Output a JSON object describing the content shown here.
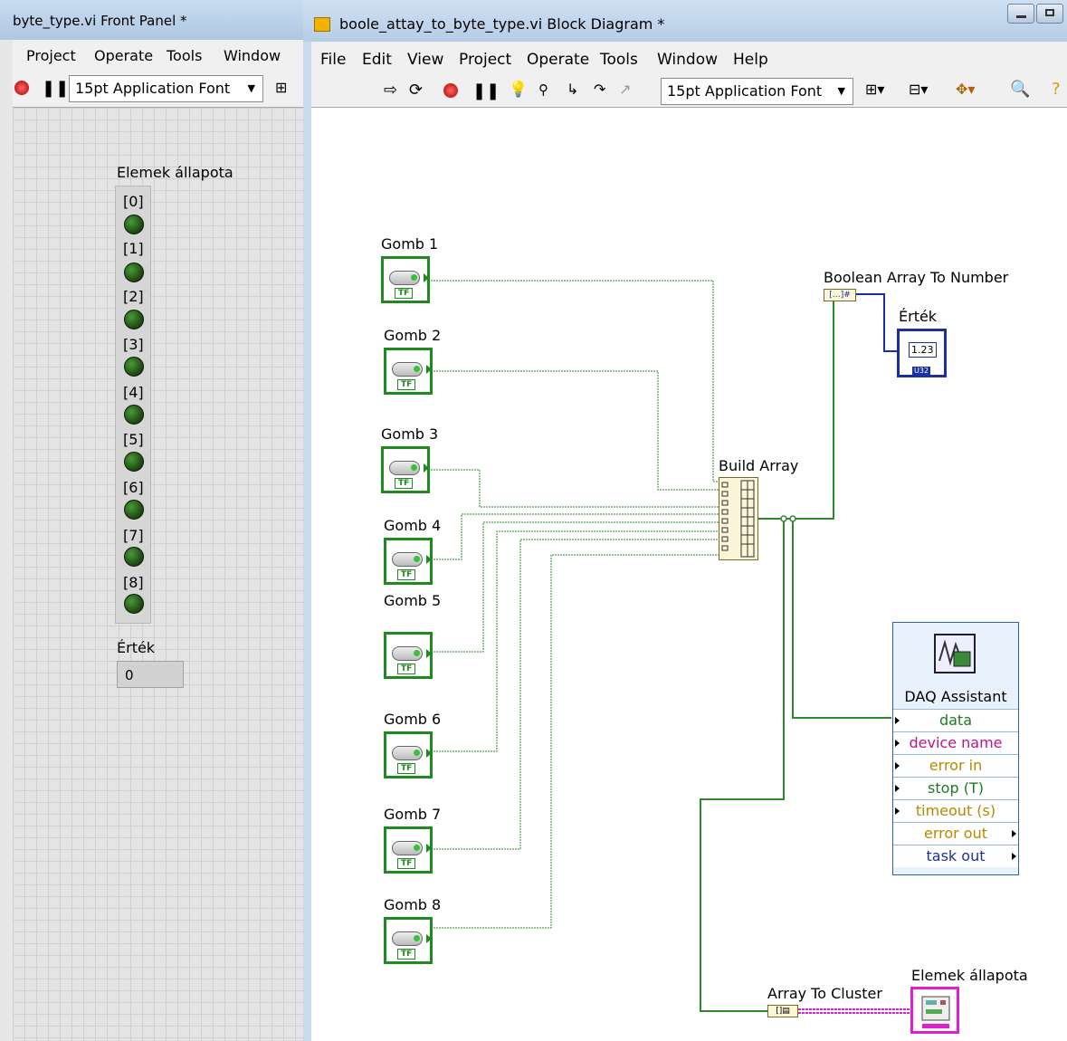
{
  "front_panel": {
    "title": "byte_type.vi Front Panel *",
    "menu": [
      "Project",
      "Operate",
      "Tools",
      "Window"
    ],
    "font_selector": "15pt Application Font",
    "array_label": "Elemek állapota",
    "indices": [
      "[0]",
      "[1]",
      "[2]",
      "[3]",
      "[4]",
      "[5]",
      "[6]",
      "[7]",
      "[8]"
    ],
    "numeric_label": "Érték",
    "numeric_value": "0"
  },
  "block_diagram": {
    "title": "boole_attay_to_byte_type.vi Block Diagram *",
    "menu": [
      "File",
      "Edit",
      "View",
      "Project",
      "Operate",
      "Tools",
      "Window",
      "Help"
    ],
    "font_selector": "15pt Application Font",
    "buttons": [
      "Gomb 1",
      "Gomb  2",
      "Gomb 3",
      "Gomb 4",
      "Gomb 5",
      "Gomb 6",
      "Gomb 7",
      "Gomb 8"
    ],
    "build_array": "Build Array",
    "bool_to_num": "Boolean Array To Number",
    "ertek": "Érték",
    "ertek_num": "1.23",
    "ertek_type": "U32",
    "array_to_cluster": "Array To Cluster",
    "cluster_out": "Elemek állapota",
    "daq": {
      "title": "DAQ Assistant",
      "rows": [
        "data",
        "device name",
        "error in",
        "stop (T)",
        "timeout (s)",
        "error out",
        "task out"
      ]
    }
  },
  "colors": {
    "bool_wire": "#2c8a2c",
    "numeric_wire": "#1a2fa0",
    "cluster_wire": "#e020d0",
    "daq_row_text": [
      "#1f7a1f",
      "#c0118a",
      "#b58a00",
      "#1f7a1f",
      "#b58a00",
      "#b58a00",
      "#1a2fa0"
    ]
  }
}
